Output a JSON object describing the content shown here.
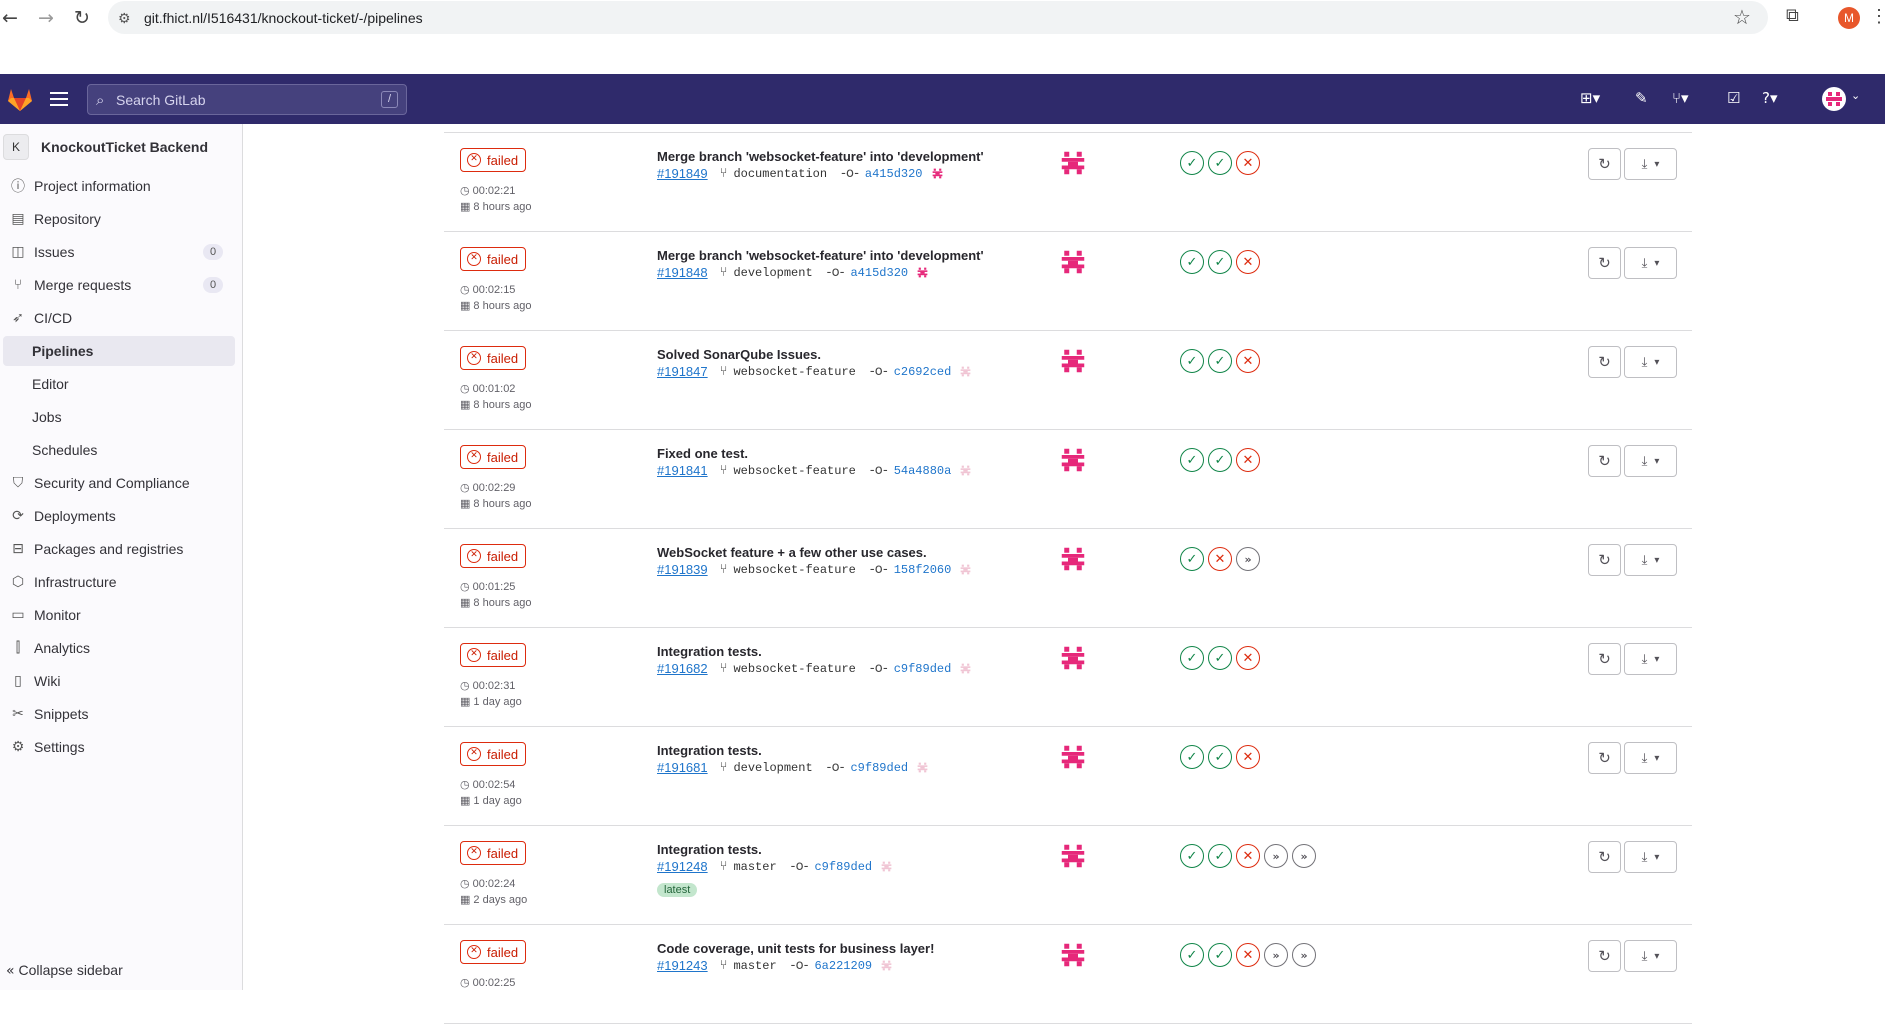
{
  "browser": {
    "url": "git.fhict.nl/I516431/knockout-ticket/-/pipelines",
    "profile_initial": "M"
  },
  "header": {
    "search_placeholder": "Search GitLab",
    "search_shortcut": "/"
  },
  "sidebar": {
    "project_initial": "K",
    "project_name": "KnockoutTicket Backend",
    "items": [
      {
        "label": "Project information",
        "icon": "info-icon"
      },
      {
        "label": "Repository",
        "icon": "doc-icon"
      },
      {
        "label": "Issues",
        "icon": "issues-icon",
        "count": "0"
      },
      {
        "label": "Merge requests",
        "icon": "merge-icon",
        "count": "0"
      },
      {
        "label": "CI/CD",
        "icon": "rocket-icon"
      },
      {
        "label": "Security and Compliance",
        "icon": "shield-icon"
      },
      {
        "label": "Deployments",
        "icon": "deploy-icon"
      },
      {
        "label": "Packages and registries",
        "icon": "package-icon"
      },
      {
        "label": "Infrastructure",
        "icon": "infra-icon"
      },
      {
        "label": "Monitor",
        "icon": "monitor-icon"
      },
      {
        "label": "Analytics",
        "icon": "chart-icon"
      },
      {
        "label": "Wiki",
        "icon": "book-icon"
      },
      {
        "label": "Snippets",
        "icon": "scissors-icon"
      },
      {
        "label": "Settings",
        "icon": "gear-icon"
      }
    ],
    "cicd_sub": [
      "Pipelines",
      "Editor",
      "Jobs",
      "Schedules"
    ],
    "active_sub": "Pipelines",
    "collapse_label": "Collapse sidebar"
  },
  "status_label": "failed",
  "latest_label": "latest",
  "pipelines": [
    {
      "title": "Merge branch 'websocket-feature' into 'development'",
      "id": "#191849",
      "branch": "documentation",
      "sha": "a415d320",
      "duration": "00:02:21",
      "ago": "8 hours ago",
      "stages": [
        "ok",
        "ok",
        "fail"
      ]
    },
    {
      "title": "Merge branch 'websocket-feature' into 'development'",
      "id": "#191848",
      "branch": "development",
      "sha": "a415d320",
      "duration": "00:02:15",
      "ago": "8 hours ago",
      "stages": [
        "ok",
        "ok",
        "fail"
      ]
    },
    {
      "title": "Solved SonarQube Issues.",
      "id": "#191847",
      "branch": "websocket-feature",
      "sha": "c2692ced",
      "duration": "00:01:02",
      "ago": "8 hours ago",
      "stages": [
        "ok",
        "ok",
        "fail"
      ]
    },
    {
      "title": "Fixed one test.",
      "id": "#191841",
      "branch": "websocket-feature",
      "sha": "54a4880a",
      "duration": "00:02:29",
      "ago": "8 hours ago",
      "stages": [
        "ok",
        "ok",
        "fail"
      ]
    },
    {
      "title": "WebSocket feature + a few other use cases.",
      "id": "#191839",
      "branch": "websocket-feature",
      "sha": "158f2060",
      "duration": "00:01:25",
      "ago": "8 hours ago",
      "stages": [
        "ok",
        "fail",
        "skip"
      ]
    },
    {
      "title": "Integration tests.",
      "id": "#191682",
      "branch": "websocket-feature",
      "sha": "c9f89ded",
      "duration": "00:02:31",
      "ago": "1 day ago",
      "stages": [
        "ok",
        "ok",
        "fail"
      ]
    },
    {
      "title": "Integration tests.",
      "id": "#191681",
      "branch": "development",
      "sha": "c9f89ded",
      "duration": "00:02:54",
      "ago": "1 day ago",
      "stages": [
        "ok",
        "ok",
        "fail"
      ]
    },
    {
      "title": "Integration tests.",
      "id": "#191248",
      "branch": "master",
      "sha": "c9f89ded",
      "duration": "00:02:24",
      "ago": "2 days ago",
      "stages": [
        "ok",
        "ok",
        "fail",
        "skip",
        "skip"
      ],
      "latest": true
    },
    {
      "title": "Code coverage, unit tests for business layer!",
      "id": "#191243",
      "branch": "master",
      "sha": "6a221209",
      "duration": "00:02:25",
      "ago": "",
      "stages": [
        "ok",
        "ok",
        "fail",
        "skip",
        "skip"
      ]
    }
  ]
}
